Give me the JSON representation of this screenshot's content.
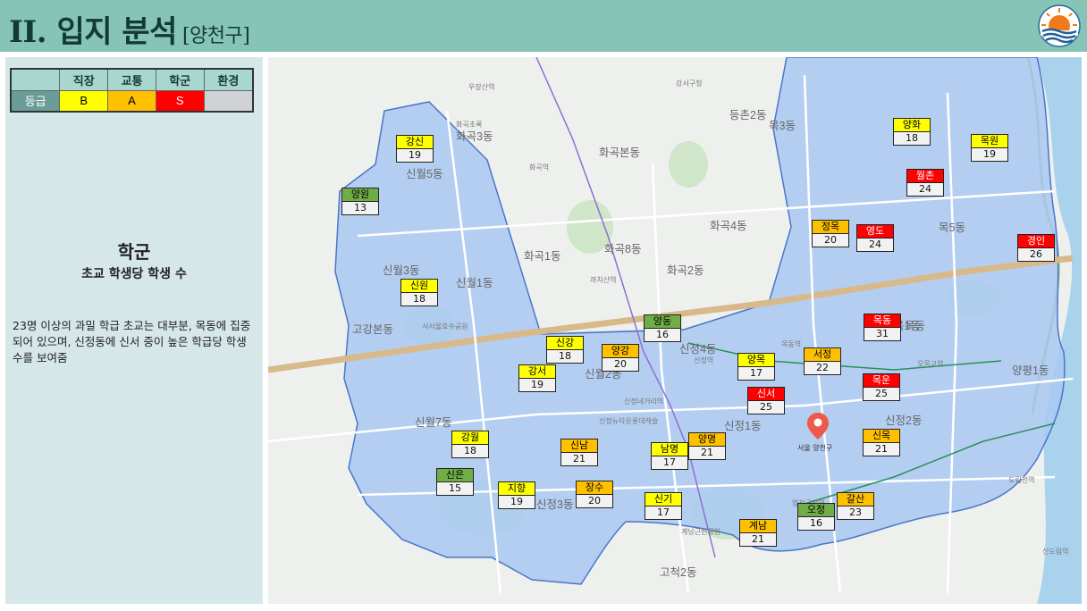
{
  "header": {
    "title": "II. 입지 분석",
    "subtitle": "[양천구]",
    "logo_icon": "sun-over-waves-logo",
    "bg_color": "#86c4b8"
  },
  "grade_table": {
    "columns": [
      "직장",
      "교통",
      "학군",
      "환경"
    ],
    "row_label": "등급",
    "values": [
      "B",
      "A",
      "S",
      ""
    ],
    "colors": [
      "#ffff00",
      "#ffc000",
      "#ff0000",
      "#d0d2d6"
    ]
  },
  "panel": {
    "category": "학군",
    "metric": "초교 학생당 학생 수",
    "description": "23명 이상의 과밀 학급 초교는 대부분, 목동에 집중되어 있으며, 신정동에 신서 중이 높은 학급당 학생 수를 보여줌"
  },
  "map": {
    "region_color": "#a9c8f2",
    "district_labels": [
      "신월5동",
      "신월3동",
      "신월1동",
      "신월7동",
      "신월2동",
      "신정3동",
      "신정4동",
      "신정1동",
      "신정2동",
      "목3동",
      "목5동",
      "목1동",
      "화곡본동",
      "화곡1동",
      "화곡8동",
      "화곡2동",
      "화곡4동",
      "화곡3동",
      "고강본동",
      "등촌2동",
      "양평1동",
      "고척2동",
      "목동"
    ],
    "place_labels": [
      "강서구청",
      "우장산역",
      "화곡역",
      "까치산역",
      "신정역",
      "목동역",
      "오목교역",
      "신정네거리역",
      "양천구청역",
      "서울 양천구",
      "화곡초록",
      "서서울호수공원",
      "신정뉴타운롯데캐슬",
      "계남근린공원",
      "신도림역",
      "도림천역"
    ],
    "pin_label": "서울 양천구",
    "schools": [
      {
        "name": "강신",
        "value": "19",
        "level": "y"
      },
      {
        "name": "양원",
        "value": "13",
        "level": "g"
      },
      {
        "name": "신원",
        "value": "18",
        "level": "y"
      },
      {
        "name": "신강",
        "value": "18",
        "level": "y"
      },
      {
        "name": "강서",
        "value": "19",
        "level": "y"
      },
      {
        "name": "양강",
        "value": "20",
        "level": "o"
      },
      {
        "name": "양동",
        "value": "16",
        "level": "g"
      },
      {
        "name": "강월",
        "value": "18",
        "level": "y"
      },
      {
        "name": "신남",
        "value": "21",
        "level": "o"
      },
      {
        "name": "신은",
        "value": "15",
        "level": "g"
      },
      {
        "name": "지향",
        "value": "19",
        "level": "y"
      },
      {
        "name": "장수",
        "value": "20",
        "level": "o"
      },
      {
        "name": "남명",
        "value": "17",
        "level": "y"
      },
      {
        "name": "양명",
        "value": "21",
        "level": "o"
      },
      {
        "name": "신기",
        "value": "17",
        "level": "y"
      },
      {
        "name": "양목",
        "value": "17",
        "level": "y"
      },
      {
        "name": "서정",
        "value": "22",
        "level": "o"
      },
      {
        "name": "신서",
        "value": "25",
        "level": "r"
      },
      {
        "name": "목운",
        "value": "25",
        "level": "r"
      },
      {
        "name": "신목",
        "value": "21",
        "level": "o"
      },
      {
        "name": "갈산",
        "value": "23",
        "level": "o"
      },
      {
        "name": "계남",
        "value": "21",
        "level": "o"
      },
      {
        "name": "오정",
        "value": "16",
        "level": "g"
      },
      {
        "name": "목동",
        "value": "31",
        "level": "r"
      },
      {
        "name": "정목",
        "value": "20",
        "level": "o"
      },
      {
        "name": "영도",
        "value": "24",
        "level": "r"
      },
      {
        "name": "월촌",
        "value": "24",
        "level": "r"
      },
      {
        "name": "경인",
        "value": "26",
        "level": "r"
      },
      {
        "name": "양화",
        "value": "18",
        "level": "y"
      },
      {
        "name": "목원",
        "value": "19",
        "level": "y"
      }
    ]
  }
}
